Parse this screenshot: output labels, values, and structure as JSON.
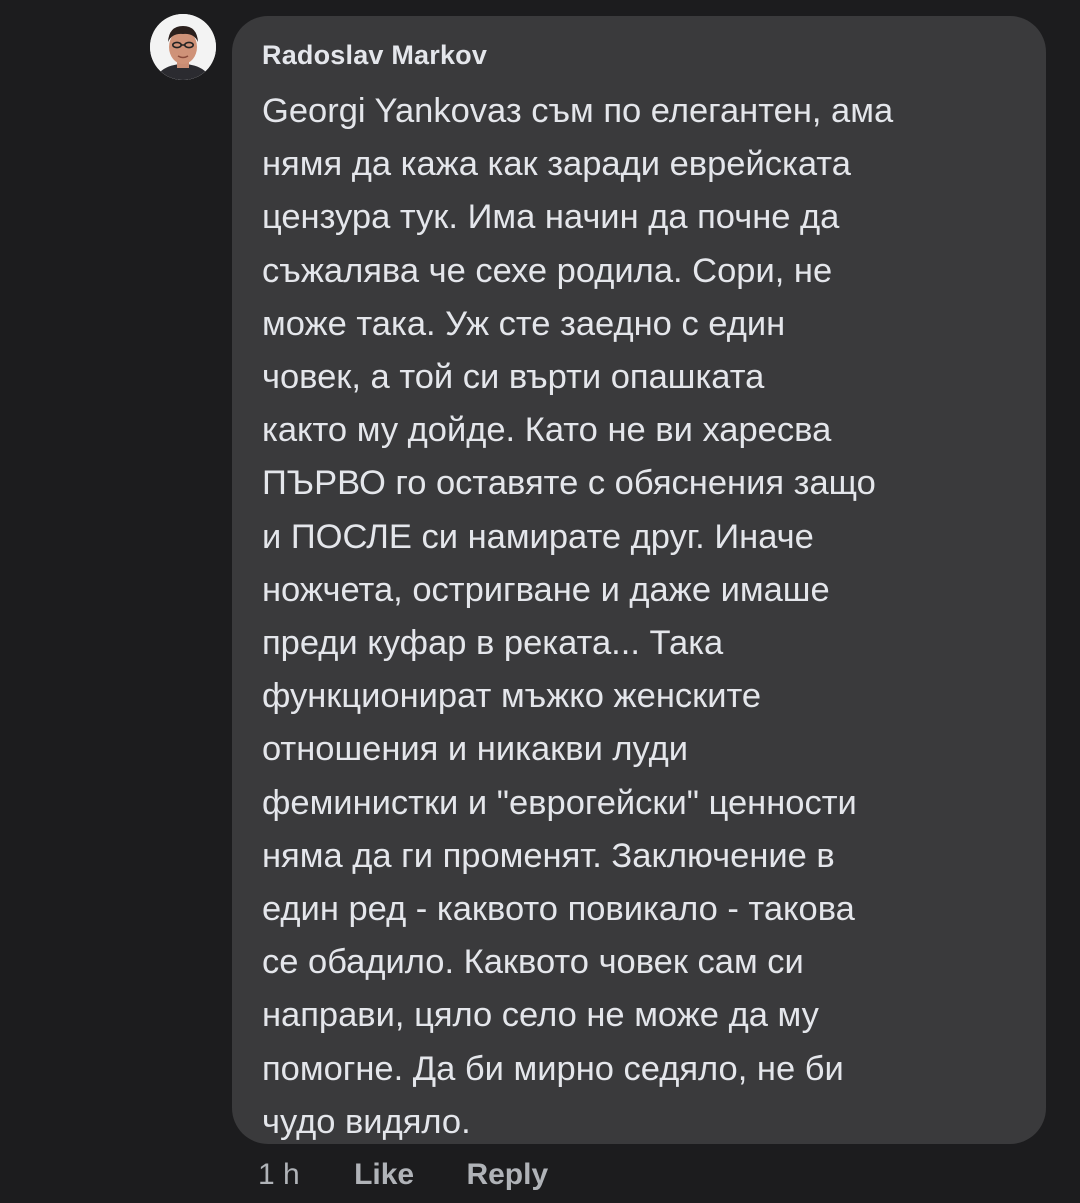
{
  "comment": {
    "author": "Radoslav Markov",
    "text_lines": [
      "Georgi Yankovаз съм по елегантен, ама",
      "нямя да кажа как заради еврейската",
      "цензура тук. Има начин да почне да",
      "съжалява че сехе родила. Сори, не",
      "може така. Уж сте заедно с един",
      "човек, а той си върти опашката",
      "както му дойде. Като не ви харесва",
      "ПЪРВО го оставяте с обяснения защо",
      "и ПОСЛЕ си намирате друг. Иначе",
      "ножчета, остригване и даже имаше",
      "преди куфар в реката... Така",
      "функционират мъжко женските",
      "отношения и никакви луди",
      "феминистки и \"еврогейски\" ценности",
      "няма да ги променят. Заключение в",
      "един ред - каквото повикало - такова",
      "се обадило. Каквото човек сам си",
      "направи, цяло село не може да му",
      "помогне. Да би мирно седяло, не би",
      "чудо видяло."
    ],
    "time": "1 h",
    "like_label": "Like",
    "reply_label": "Reply"
  },
  "colors": {
    "background": "#1c1c1e",
    "bubble": "#3a3a3c",
    "text": "#e4e6eb",
    "secondary_text": "#b0b3b8"
  },
  "icons": {
    "avatar": "profile-photo"
  }
}
